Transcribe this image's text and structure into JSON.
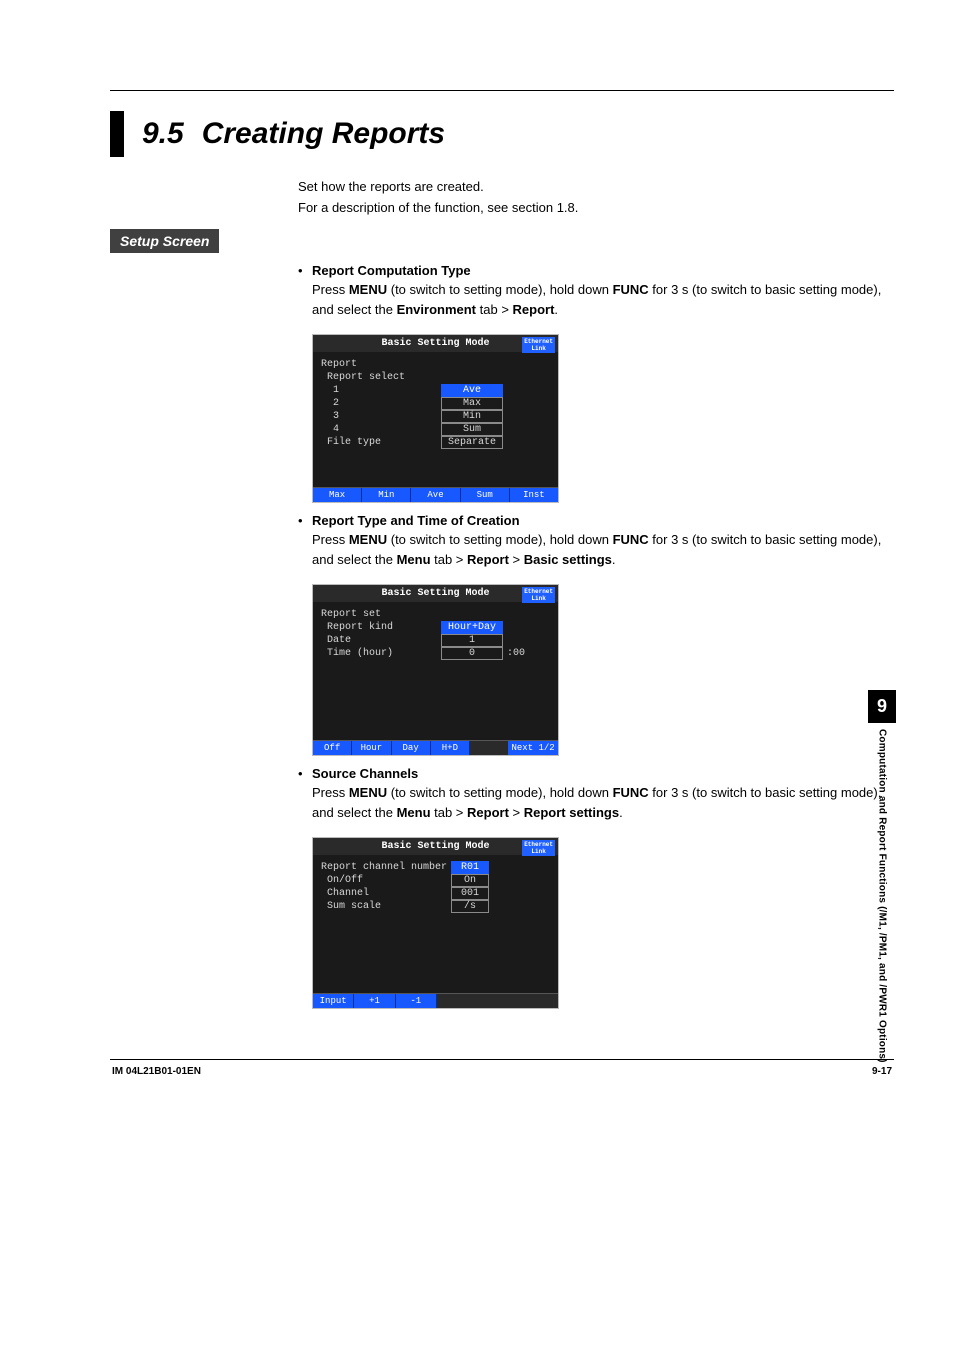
{
  "header": {
    "section_number": "9.5",
    "section_title": "Creating Reports"
  },
  "intro": {
    "line1": "Set how the reports are created.",
    "line2": "For a description of the function, see section 1.8."
  },
  "setup_label": "Setup Screen",
  "section1": {
    "bullet": "•",
    "title": "Report Computation Type",
    "text_pre": "Press ",
    "menu": "MENU",
    "text_mid1": " (to switch to setting mode), hold down ",
    "func": "FUNC",
    "text_mid2": " for 3 s (to switch to basic setting mode), and select the ",
    "tab": "Environment",
    "text_mid3": " tab > ",
    "dest": "Report",
    "text_end": "."
  },
  "screen1": {
    "title": "Basic Setting Mode",
    "eth1": "Ethernet",
    "eth2": "Link",
    "rows": {
      "h1": "Report",
      "h2": " Report select",
      "r1l": "  1",
      "r1v": "Ave",
      "r2l": "  2",
      "r2v": "Max",
      "r3l": "  3",
      "r3v": "Min",
      "r4l": "  4",
      "r4v": "Sum",
      "ftl": " File type",
      "ftv": "Separate"
    },
    "sk": {
      "a": "Max",
      "b": "Min",
      "c": "Ave",
      "d": "Sum",
      "e": "Inst"
    }
  },
  "section2": {
    "bullet": "•",
    "title": "Report Type and Time of Creation",
    "text_pre": "Press ",
    "menu": "MENU",
    "text_mid1": " (to switch to setting mode), hold down ",
    "func": "FUNC",
    "text_mid2": " for 3 s (to switch to basic setting mode), and select the ",
    "tab": "Menu",
    "text_mid3": " tab > ",
    "p1": "Report",
    "gt": " > ",
    "p2": "Basic settings",
    "text_end": "."
  },
  "screen2": {
    "title": "Basic Setting Mode",
    "eth1": "Ethernet",
    "eth2": "Link",
    "rows": {
      "h1": "Report set",
      "r1l": " Report kind",
      "r1v": "Hour+Day",
      "r2l": " Date",
      "r2v": "1",
      "r3l": " Time (hour)",
      "r3v": "0",
      "r3a": ":00"
    },
    "sk": {
      "a": "Off",
      "b": "Hour",
      "c": "Day",
      "d": "H+D",
      "gap": "",
      "e": "Next 1/2"
    }
  },
  "section3": {
    "bullet": "•",
    "title": "Source Channels",
    "text_pre": "Press ",
    "menu": "MENU",
    "text_mid1": " (to switch to setting mode), hold down ",
    "func": "FUNC",
    "text_mid2": " for 3 s (to switch to basic setting mode), and select the ",
    "tab": "Menu",
    "text_mid3": " tab > ",
    "p1": "Report",
    "gt": " > ",
    "p2": "Report settings",
    "text_end": "."
  },
  "screen3": {
    "title": "Basic Setting Mode",
    "eth1": "Ethernet",
    "eth2": "Link",
    "rows": {
      "r0l": "Report channel number",
      "r0v": "R01",
      "r1l": " On/Off",
      "r1v": "On",
      "r2l": " Channel",
      "r2v": "001",
      "r3l": " Sum scale",
      "r3v": "/s"
    },
    "sk": {
      "a": "Input",
      "b": "+1",
      "c": "-1"
    }
  },
  "sidetab": {
    "num": "9",
    "text": "Computation and Report Functions (/M1, /PM1, and /PWR1 Options)"
  },
  "footer": {
    "left": "IM 04L21B01-01EN",
    "right": "9-17"
  }
}
